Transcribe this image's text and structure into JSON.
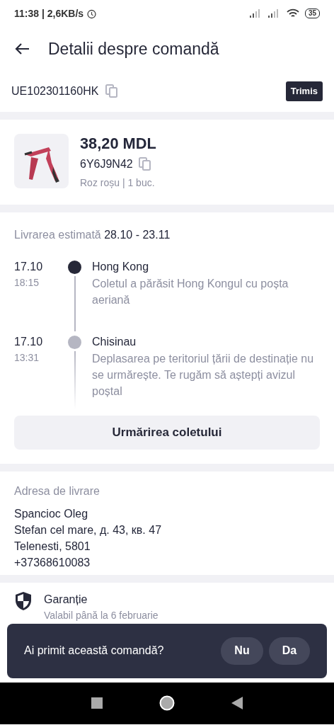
{
  "status_bar": {
    "time": "11:38 | 2,6KB/s",
    "battery": "35"
  },
  "header": {
    "title": "Detalii despre comandă"
  },
  "tracking": {
    "number": "UE102301160HK",
    "status": "Trimis"
  },
  "product": {
    "price": "38,20 MDL",
    "code": "6Y6J9N42",
    "variant": "Roz roșu | 1 buc."
  },
  "delivery": {
    "label": "Livrarea estimată",
    "dates": "28.10 - 23.11"
  },
  "events": [
    {
      "date": "17.10",
      "time": "18:15",
      "place": "Hong Kong",
      "description": "Coletul a părăsit Hong Kongul cu poșta aeriană",
      "current": true
    },
    {
      "date": "17.10",
      "time": "13:31",
      "place": "Chisinau",
      "description": "Deplasarea pe teritoriul țării de destinație nu se urmărește. Te rugăm să aștepți avizul poștal",
      "current": false
    }
  ],
  "track_button": "Urmărirea coletului",
  "address": {
    "heading": "Adresa de livrare",
    "lines": [
      "Spancioc Oleg",
      "Stefan cel mare, д. 43, кв. 47",
      "Telenesti, 5801",
      "+37368610083"
    ]
  },
  "warranty": {
    "title": "Garanție",
    "subtitle": "Valabil până la 6 februarie"
  },
  "prompt": {
    "question": "Ai primit această comandă?",
    "buttons": [
      "Nu",
      "Da"
    ]
  }
}
